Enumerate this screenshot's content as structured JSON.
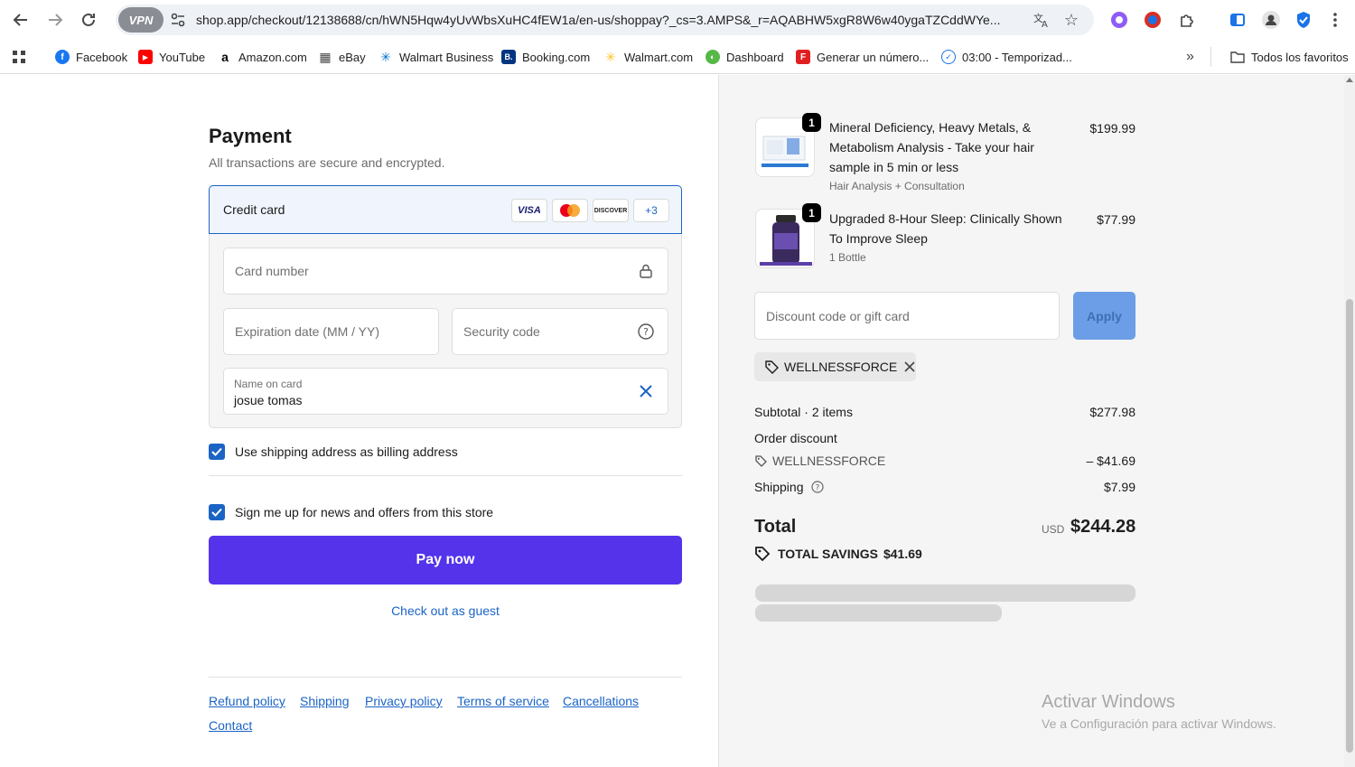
{
  "browser": {
    "url": "shop.app/checkout/12138688/cn/hWN5Hqw4yUvWbsXuHC4fEW1a/en-us/shoppay?_cs=3.AMPS&_r=AQABHW5xgR8W6w40ygaTZCddWYe...",
    "vpn_label": "VPN"
  },
  "bookmarks": [
    {
      "label": "Facebook",
      "color": "#1877f2",
      "glyph": "f"
    },
    {
      "label": "YouTube",
      "color": "#ff0000",
      "glyph": "▶"
    },
    {
      "label": "Amazon.com",
      "color": "#000000",
      "glyph": "a"
    },
    {
      "label": "eBay",
      "color": "#e53238",
      "glyph": "▦"
    },
    {
      "label": "Walmart Business",
      "color": "#0071ce",
      "glyph": "✳"
    },
    {
      "label": "Booking.com",
      "color": "#003580",
      "glyph": "B."
    },
    {
      "label": "Walmart.com",
      "color": "#ffc220",
      "glyph": "✳"
    },
    {
      "label": "Dashboard",
      "color": "#56b847",
      "glyph": "◐"
    },
    {
      "label": "Generar un número...",
      "color": "#e02020",
      "glyph": "F"
    },
    {
      "label": "03:00 - Temporizad...",
      "color": "#1a73e8",
      "glyph": "✓"
    }
  ],
  "bookmarks_all": "Todos los favoritos",
  "payment": {
    "title": "Payment",
    "subtitle": "All transactions are secure and encrypted.",
    "method_label": "Credit card",
    "card_brands": [
      "VISA",
      "Mastercard",
      "DISCOVER"
    ],
    "more_brands": "+3",
    "card_number_placeholder": "Card number",
    "expiration_placeholder": "Expiration date (MM / YY)",
    "security_placeholder": "Security code",
    "name_label": "Name on card",
    "name_value": "josue tomas",
    "billing_checkbox": "Use shipping address as billing address",
    "news_checkbox": "Sign me up for news and offers from this store",
    "pay_button": "Pay now",
    "guest_link": "Check out as guest"
  },
  "footer_links": [
    "Refund policy",
    "Shipping",
    "Privacy policy",
    "Terms of service",
    "Cancellations",
    "Contact"
  ],
  "summary": {
    "items": [
      {
        "qty": "1",
        "name_lines": [
          "Mineral Deficiency, Heavy Metals, &",
          "Metabolism Analysis - Take your hair",
          "sample in 5 min or less"
        ],
        "variant": "Hair Analysis + Consultation",
        "price": "$199.99"
      },
      {
        "qty": "1",
        "name_lines": [
          "Upgraded 8-Hour Sleep: Clinically Shown",
          "To Improve Sleep"
        ],
        "variant": "1 Bottle",
        "price": "$77.99"
      }
    ],
    "discount_placeholder": "Discount code or gift card",
    "apply_button": "Apply",
    "applied_code": "WELLNESSFORCE",
    "subtotal_label": "Subtotal · 2 items",
    "subtotal_value": "$277.98",
    "order_discount_label": "Order discount",
    "discount_code": "WELLNESSFORCE",
    "discount_value": "– $41.69",
    "shipping_label": "Shipping",
    "shipping_value": "$7.99",
    "total_label": "Total",
    "currency": "USD",
    "total_value": "$244.28",
    "savings_label": "TOTAL SAVINGS",
    "savings_value": "$41.69"
  },
  "watermark": {
    "line1": "Activar Windows",
    "line2": "Ve a Configuración para activar Windows."
  }
}
